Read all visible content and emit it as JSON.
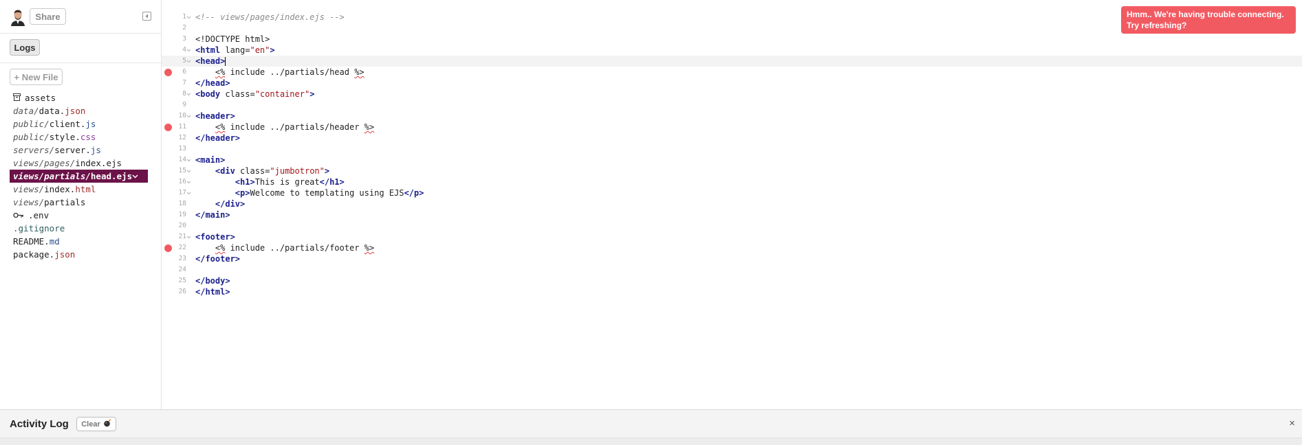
{
  "sidebar": {
    "share_label": "Share",
    "logs_label": "Logs",
    "new_file_label": "+ New File",
    "files": [
      {
        "icon": "box-icon",
        "dir": "",
        "name": "assets",
        "ext": "",
        "ext_class": ""
      },
      {
        "icon": "",
        "dir": "data/",
        "name": "data.",
        "ext": "json",
        "ext_class": "ext-json"
      },
      {
        "icon": "",
        "dir": "public/",
        "name": "client.",
        "ext": "js",
        "ext_class": "ext-js"
      },
      {
        "icon": "",
        "dir": "public/",
        "name": "style.",
        "ext": "css",
        "ext_class": "ext-css"
      },
      {
        "icon": "",
        "dir": "servers/",
        "name": "server.",
        "ext": "js",
        "ext_class": "ext-js"
      },
      {
        "icon": "",
        "dir": "views/pages/",
        "name": "index.ejs",
        "ext": "",
        "ext_class": ""
      },
      {
        "icon": "",
        "dir": "views/partials/",
        "name": "head.ejs",
        "ext": "",
        "ext_class": "",
        "active": true
      },
      {
        "icon": "",
        "dir": "views/",
        "name": "index.",
        "ext": "html",
        "ext_class": "ext-html"
      },
      {
        "icon": "",
        "dir": "views/",
        "name": "partials",
        "ext": "",
        "ext_class": ""
      },
      {
        "icon": "key-icon",
        "dir": "",
        "name": ".env",
        "ext": "",
        "ext_class": ""
      },
      {
        "icon": "",
        "dir": "",
        "name": ".gitignore",
        "ext": "",
        "ext_class": "gitignore"
      },
      {
        "icon": "",
        "dir": "",
        "name": "README.",
        "ext": "md",
        "ext_class": "ext-md"
      },
      {
        "icon": "",
        "dir": "",
        "name": "package.",
        "ext": "json",
        "ext_class": "ext-json"
      }
    ]
  },
  "editor": {
    "lines": [
      {
        "n": "1",
        "fold": true,
        "bp": false,
        "parts": [
          [
            "c-comment",
            "<!-- views/pages/index.ejs -->"
          ]
        ]
      },
      {
        "n": "2",
        "fold": false,
        "bp": false,
        "parts": []
      },
      {
        "n": "3",
        "fold": false,
        "bp": false,
        "parts": [
          [
            "",
            "<!DOCTYPE html>"
          ]
        ]
      },
      {
        "n": "4",
        "fold": true,
        "bp": false,
        "parts": [
          [
            "c-tag",
            "<html"
          ],
          [
            "",
            " lang="
          ],
          [
            "c-str",
            "\"en\""
          ],
          [
            "c-tag",
            ">"
          ]
        ]
      },
      {
        "n": "5",
        "fold": true,
        "bp": false,
        "current": true,
        "parts": [
          [
            "c-tag",
            "<head>"
          ],
          [
            "caret",
            ""
          ]
        ]
      },
      {
        "n": "6",
        "fold": false,
        "bp": true,
        "parts": [
          [
            "",
            "    "
          ],
          [
            "ejs",
            "<%"
          ],
          [
            "",
            " include ../partials/head "
          ],
          [
            "ejs",
            "%>"
          ]
        ]
      },
      {
        "n": "7",
        "fold": false,
        "bp": false,
        "parts": [
          [
            "c-tag",
            "</head>"
          ]
        ]
      },
      {
        "n": "8",
        "fold": true,
        "bp": false,
        "parts": [
          [
            "c-tag",
            "<body"
          ],
          [
            "",
            " class="
          ],
          [
            "c-str",
            "\"container\""
          ],
          [
            "c-tag",
            ">"
          ]
        ]
      },
      {
        "n": "9",
        "fold": false,
        "bp": false,
        "parts": []
      },
      {
        "n": "10",
        "fold": true,
        "bp": false,
        "parts": [
          [
            "c-tag",
            "<header>"
          ]
        ]
      },
      {
        "n": "11",
        "fold": false,
        "bp": true,
        "parts": [
          [
            "",
            "    "
          ],
          [
            "ejs",
            "<%"
          ],
          [
            "",
            " include ../partials/header "
          ],
          [
            "ejs",
            "%>"
          ]
        ]
      },
      {
        "n": "12",
        "fold": false,
        "bp": false,
        "parts": [
          [
            "c-tag",
            "</header>"
          ]
        ]
      },
      {
        "n": "13",
        "fold": false,
        "bp": false,
        "parts": []
      },
      {
        "n": "14",
        "fold": true,
        "bp": false,
        "parts": [
          [
            "c-tag",
            "<main>"
          ]
        ]
      },
      {
        "n": "15",
        "fold": true,
        "bp": false,
        "parts": [
          [
            "",
            "    "
          ],
          [
            "c-tag",
            "<div"
          ],
          [
            "",
            " class="
          ],
          [
            "c-str",
            "\"jumbotron\""
          ],
          [
            "c-tag",
            ">"
          ]
        ]
      },
      {
        "n": "16",
        "fold": true,
        "bp": false,
        "parts": [
          [
            "",
            "        "
          ],
          [
            "c-tag",
            "<h1>"
          ],
          [
            "",
            "This is great"
          ],
          [
            "c-tag",
            "</h1>"
          ]
        ]
      },
      {
        "n": "17",
        "fold": true,
        "bp": false,
        "parts": [
          [
            "",
            "        "
          ],
          [
            "c-tag",
            "<p>"
          ],
          [
            "",
            "Welcome to templating using EJS"
          ],
          [
            "c-tag",
            "</p>"
          ]
        ]
      },
      {
        "n": "18",
        "fold": false,
        "bp": false,
        "parts": [
          [
            "",
            "    "
          ],
          [
            "c-tag",
            "</div>"
          ]
        ]
      },
      {
        "n": "19",
        "fold": false,
        "bp": false,
        "parts": [
          [
            "c-tag",
            "</main>"
          ]
        ]
      },
      {
        "n": "20",
        "fold": false,
        "bp": false,
        "parts": []
      },
      {
        "n": "21",
        "fold": true,
        "bp": false,
        "parts": [
          [
            "c-tag",
            "<footer>"
          ]
        ]
      },
      {
        "n": "22",
        "fold": false,
        "bp": true,
        "parts": [
          [
            "",
            "    "
          ],
          [
            "ejs",
            "<%"
          ],
          [
            "",
            " include ../partials/footer "
          ],
          [
            "ejs",
            "%>"
          ]
        ]
      },
      {
        "n": "23",
        "fold": false,
        "bp": false,
        "parts": [
          [
            "c-tag",
            "</footer>"
          ]
        ]
      },
      {
        "n": "24",
        "fold": false,
        "bp": false,
        "parts": []
      },
      {
        "n": "25",
        "fold": false,
        "bp": false,
        "parts": [
          [
            "c-tag",
            "</body>"
          ]
        ]
      },
      {
        "n": "26",
        "fold": false,
        "bp": false,
        "parts": [
          [
            "c-tag",
            "</html>"
          ]
        ]
      }
    ]
  },
  "toast": {
    "line1": "Hmm.. We're having trouble connecting.",
    "line2": "Try refreshing?"
  },
  "activity": {
    "title": "Activity Log",
    "clear_label": "Clear",
    "close_glyph": "×"
  },
  "colors": {
    "active_file_bg": "#6b1349",
    "toast_bg": "#f25a62",
    "breakpoint": "#f25a62",
    "tag": "#1a1f8c",
    "string": "#a3151b"
  }
}
